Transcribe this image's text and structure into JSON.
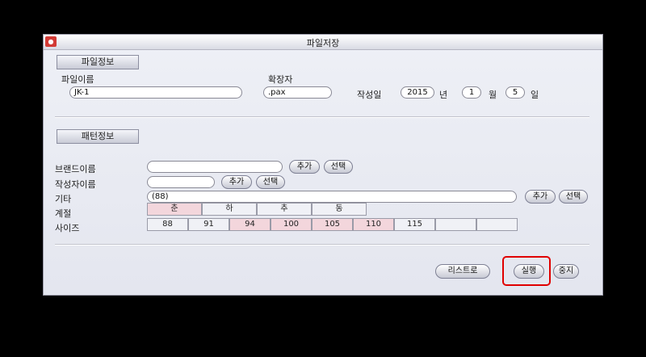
{
  "window": {
    "title": "파일저장",
    "icon_name": "app-icon"
  },
  "file_section": {
    "header": "파일정보",
    "filename_label": "파일이름",
    "filename_value": "JK-1",
    "extension_label": "확장자",
    "extension_value": ".pax",
    "date_label": "작성일",
    "year_value": "2015",
    "year_unit": "년",
    "month_value": "1",
    "month_unit": "월",
    "day_value": "5",
    "day_unit": "일"
  },
  "pattern_section": {
    "header": "패턴정보",
    "brand_label": "브랜드이름",
    "brand_value": "",
    "author_label": "작성자이름",
    "author_value": "",
    "etc_label": "기타",
    "etc_value": "(88)",
    "add_label": "추가",
    "select_label": "선택",
    "season_label": "계절",
    "seasons": [
      {
        "label": "춘",
        "selected": true
      },
      {
        "label": "하",
        "selected": false
      },
      {
        "label": "추",
        "selected": false
      },
      {
        "label": "동",
        "selected": false
      }
    ],
    "size_label": "사이즈",
    "sizes": [
      {
        "label": "88",
        "selected": false
      },
      {
        "label": "91",
        "selected": false
      },
      {
        "label": "94",
        "selected": true
      },
      {
        "label": "100",
        "selected": true
      },
      {
        "label": "105",
        "selected": true
      },
      {
        "label": "110",
        "selected": true
      },
      {
        "label": "115",
        "selected": false
      },
      {
        "label": "",
        "selected": false
      },
      {
        "label": "",
        "selected": false
      }
    ]
  },
  "footer": {
    "list_button": "리스트로",
    "run_button": "실행",
    "stop_button": "중지"
  },
  "colors": {
    "selected_cell": "#f3d6dc",
    "highlight": "#e00000"
  }
}
